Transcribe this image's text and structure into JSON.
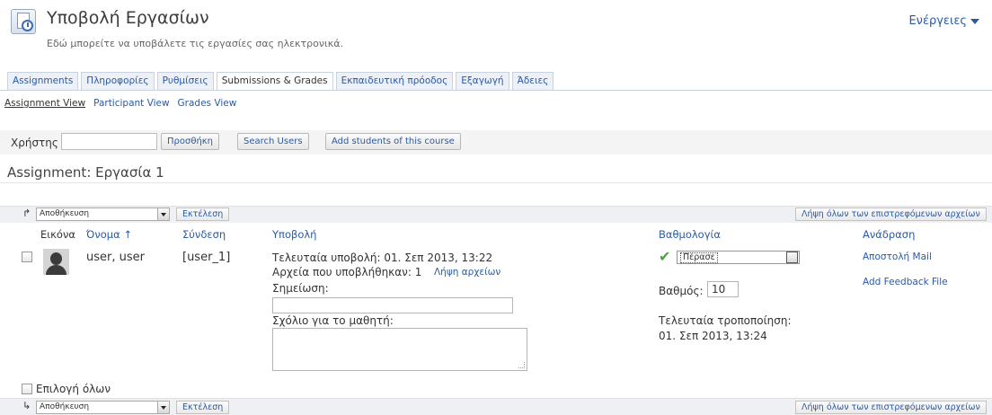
{
  "header": {
    "title": "Υποβολή Εργασίων",
    "subtitle": "Εδώ μπορείτε να υποβάλετε τις εργασίες σας ηλεκτρονικά.",
    "actions_label": "Ενέργειες"
  },
  "tabs": [
    {
      "label": "Assignments"
    },
    {
      "label": "Πληροφορίες"
    },
    {
      "label": "Ρυθμίσεις"
    },
    {
      "label": "Submissions & Grades"
    },
    {
      "label": "Εκπαιδευτική πρόοδος"
    },
    {
      "label": "Εξαγωγή"
    },
    {
      "label": "Άδειες"
    }
  ],
  "subtabs": {
    "assignment_view": "Assignment View",
    "participant_view": "Participant View",
    "grades_view": "Grades View"
  },
  "search": {
    "user_label": "Χρήστης",
    "user_value": "",
    "add_button": "Προσθήκη",
    "search_button": "Search Users",
    "add_students_button": "Add students of this course"
  },
  "assignment_title": "Assignment: Εργασία 1",
  "toolbar": {
    "action_select": "Αποθήκευση",
    "execute_button": "Εκτέλεση",
    "download_returned": "Λήψη όλων των επιστρεφόμενων αρχείων"
  },
  "table": {
    "headers": {
      "image": "Εικόνα",
      "name": "Όνομα",
      "name_sort": "↑",
      "login": "Σύνδεση",
      "submission": "Υποβολή",
      "grading": "Βαθμολογία",
      "feedback": "Ανάδραση"
    },
    "row": {
      "name": "user, user",
      "login": "[user_1]",
      "last_submission": "Τελευταία υποβολή: 01. Σεπ 2013, 13:22",
      "files_submitted": "Αρχεία που υποβλήθηκαν: 1",
      "download_files": "Λήψη αρχείων",
      "note_label": "Σημείωση:",
      "note_value": "",
      "comment_label": "Σχόλιο για το μαθητή:",
      "comment_value": "",
      "status_select": "Πέρασε",
      "grade_label": "Βαθμός:",
      "grade_value": "10",
      "last_modified_label": "Τελευταία τροποποίηση:",
      "last_modified_value": "01. Σεπ 2013, 13:24",
      "send_mail": "Αποστολή Mail",
      "add_feedback_file": "Add Feedback File"
    },
    "select_all": "Επιλογή όλων"
  },
  "colors": {
    "link": "#2a5aa5",
    "tab_bg": "#edf1f7",
    "toolbar_bg": "#eef0f3",
    "check_green": "#4aa53a"
  }
}
